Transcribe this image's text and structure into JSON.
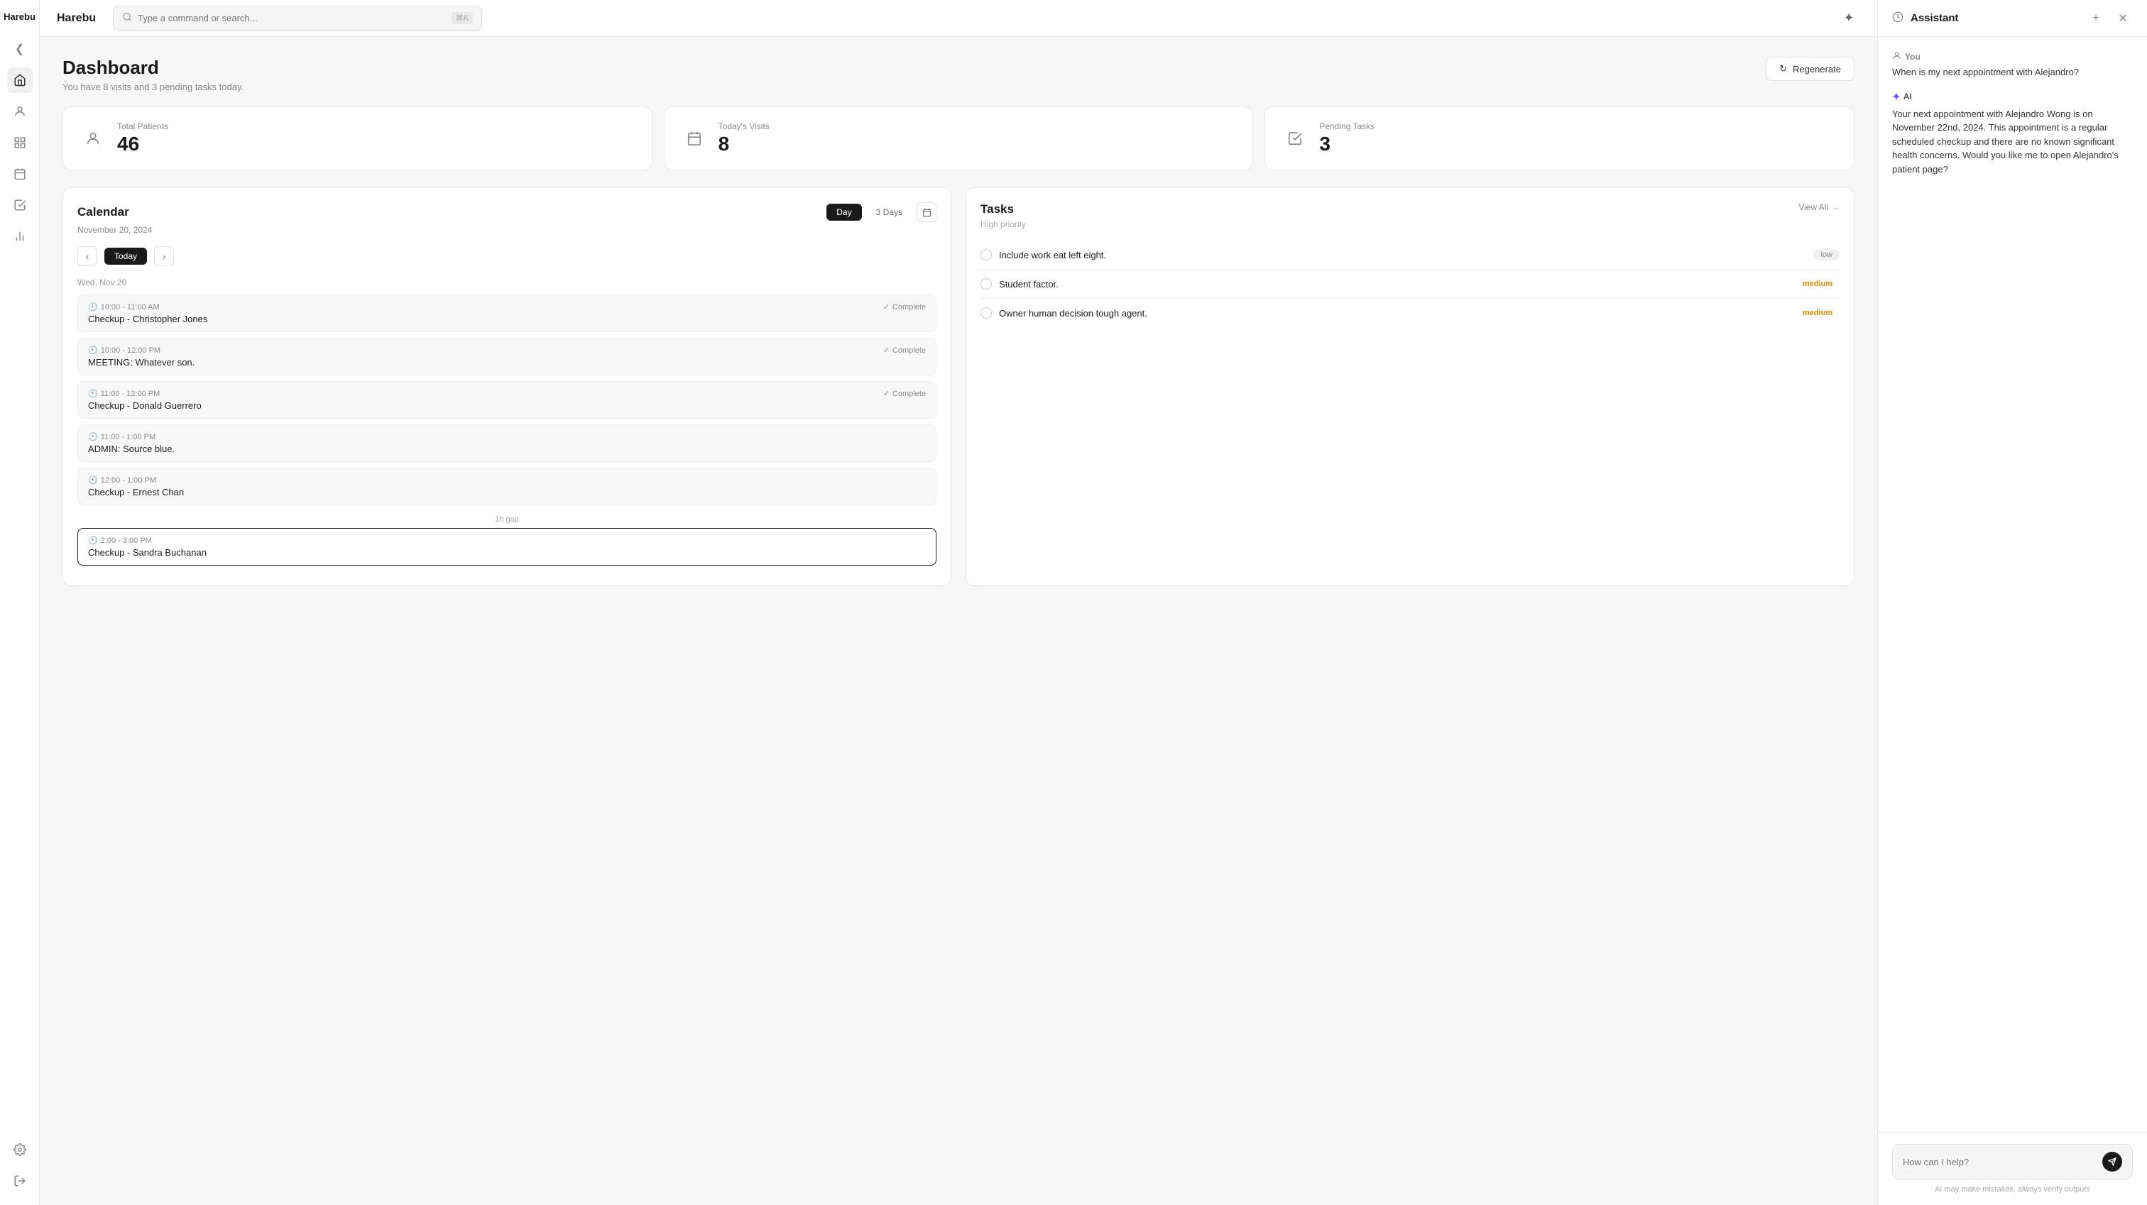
{
  "app": {
    "name": "Harebu"
  },
  "topbar": {
    "search_placeholder": "Type a command or search...",
    "search_shortcut": "⌘K"
  },
  "sidebar": {
    "items": [
      {
        "name": "collapse",
        "icon": "❮"
      },
      {
        "name": "home",
        "icon": "⌂"
      },
      {
        "name": "people",
        "icon": "👤"
      },
      {
        "name": "grid",
        "icon": "⊞"
      },
      {
        "name": "calendar",
        "icon": "📅"
      },
      {
        "name": "checklist",
        "icon": "☑"
      },
      {
        "name": "chart",
        "icon": "📊"
      }
    ],
    "bottom": [
      {
        "name": "settings",
        "icon": "⚙"
      },
      {
        "name": "logout",
        "icon": "→"
      }
    ]
  },
  "dashboard": {
    "title": "Dashboard",
    "subtitle": "You have 8 visits and 3 pending tasks today.",
    "regenerate_label": "Regenerate",
    "stats": [
      {
        "label": "Total Patients",
        "value": "46",
        "icon": "person"
      },
      {
        "label": "Today's Visits",
        "value": "8",
        "icon": "calendar"
      },
      {
        "label": "Pending Tasks",
        "value": "3",
        "icon": "check"
      }
    ]
  },
  "calendar": {
    "title": "Calendar",
    "subtitle": "November 20, 2024",
    "view_day": "Day",
    "view_3days": "3 Days",
    "nav_today": "Today",
    "day_label": "Wed, Nov 20",
    "events": [
      {
        "time": "10:00 - 11:00 AM",
        "title": "Checkup - Christopher Jones",
        "status": "Complete",
        "highlighted": false
      },
      {
        "time": "10:00 - 12:00 PM",
        "title": "MEETING: Whatever son.",
        "status": "Complete",
        "highlighted": false
      },
      {
        "time": "11:00 - 12:00 PM",
        "title": "Checkup - Donald Guerrero",
        "status": "Complete",
        "highlighted": false
      },
      {
        "time": "11:00 - 1:00 PM",
        "title": "ADMIN: Source blue.",
        "status": "",
        "highlighted": false
      },
      {
        "time": "12:00 - 1:00 PM",
        "title": "Checkup - Ernest Chan",
        "status": "",
        "highlighted": false
      }
    ],
    "gap_label": "1h gap",
    "events2": [
      {
        "time": "2:00 - 3:00 PM",
        "title": "Checkup - Sandra Buchanan",
        "status": "",
        "highlighted": true
      }
    ]
  },
  "tasks": {
    "title": "Tasks",
    "view_all": "View All",
    "priority_label": "High priority",
    "items": [
      {
        "text": "Include work eat left eight.",
        "priority": "low",
        "badge": "low"
      },
      {
        "text": "Student factor.",
        "priority": "medium",
        "badge": "medium"
      },
      {
        "text": "Owner human decision tough agent.",
        "priority": "medium",
        "badge": "medium"
      }
    ]
  },
  "assistant": {
    "title": "Assistant",
    "messages": [
      {
        "sender": "You",
        "text": "When is my next appointment with Alejandro?"
      },
      {
        "sender": "AI",
        "text": "Your next appointment with Alejandro Wong is on November 22nd, 2024. This appointment is a regular scheduled checkup and there are no known significant health concerns. Would you like me to open Alejandro's patient page?"
      }
    ],
    "input_placeholder": "How can I help?",
    "disclaimer": "AI may make mistakes, always verify outputs"
  }
}
